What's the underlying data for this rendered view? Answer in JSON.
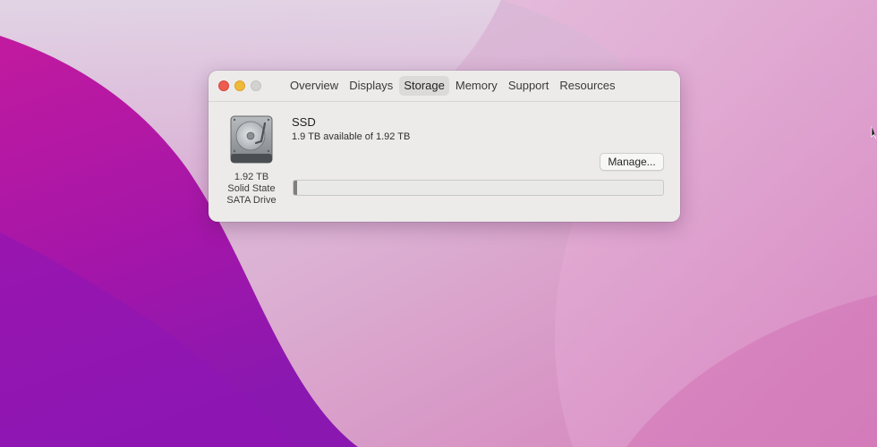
{
  "window": {
    "tabs": [
      {
        "label": "Overview",
        "active": false
      },
      {
        "label": "Displays",
        "active": false
      },
      {
        "label": "Storage",
        "active": true
      },
      {
        "label": "Memory",
        "active": false
      },
      {
        "label": "Support",
        "active": false
      },
      {
        "label": "Resources",
        "active": false
      }
    ]
  },
  "drive": {
    "icon": "hard-drive-icon",
    "capacity": "1.92 TB",
    "type": "Solid State",
    "interface": "SATA Drive",
    "name": "SSD",
    "availability": "1.9 TB available of 1.92 TB",
    "used_fraction": 0.01,
    "manage_label": "Manage..."
  },
  "colors": {
    "close": "#ec5c51",
    "minimize": "#efb93a",
    "zoom_inactive": "#d3d2d1",
    "wallpaper_magenta": "#b0199f",
    "wallpaper_pink": "#e6b5d6"
  }
}
